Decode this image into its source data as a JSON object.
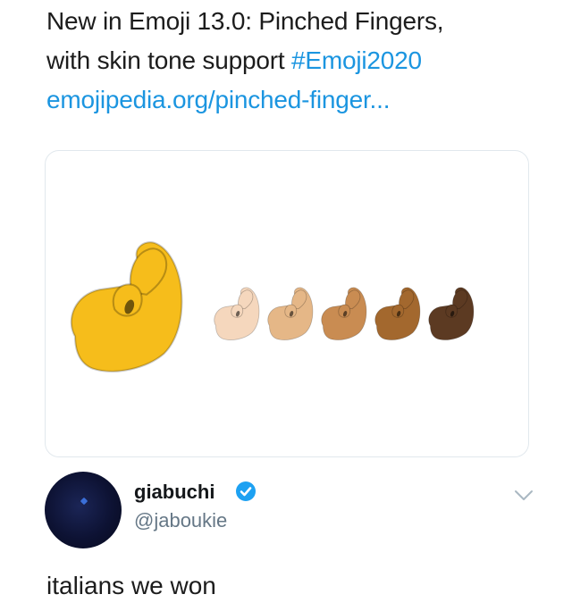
{
  "tweet": {
    "line1": "New in Emoji 13.0: Pinched Fingers,",
    "line2_text": "with skin tone support ",
    "hashtag": "#Emoji2020",
    "link": "emojipedia.org/pinched-finger..."
  },
  "card": {
    "emoji_name": "pinched-fingers",
    "colors": {
      "default": "#f6bd1b",
      "tones": [
        "#f5d7bd",
        "#e5b787",
        "#c98c52",
        "#a3682e",
        "#5c3a22"
      ]
    }
  },
  "author": {
    "display_name": "giabuchi",
    "handle": "@jaboukie",
    "verified_color": "#1da1f2"
  },
  "reply": {
    "text": "italians we won"
  }
}
